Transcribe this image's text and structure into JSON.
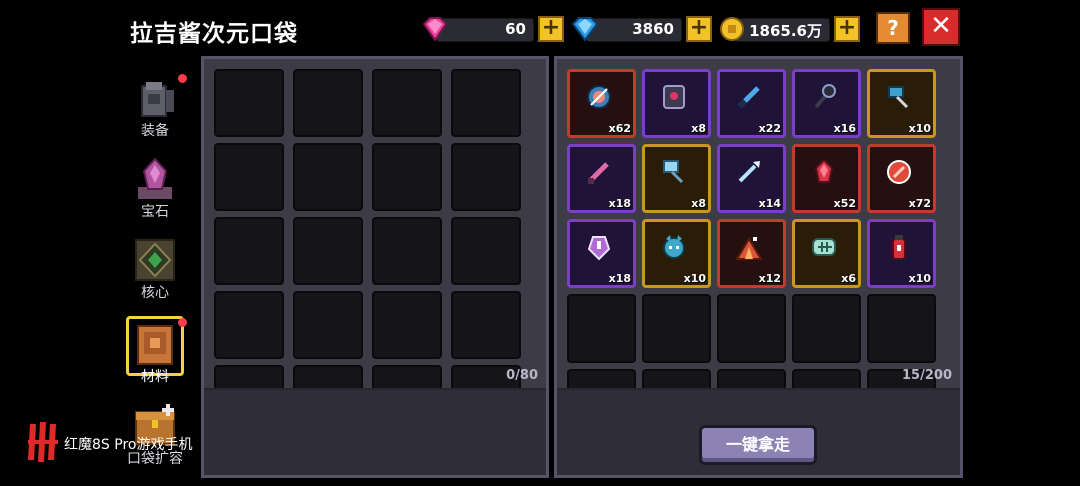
{
  "header": {
    "title": "拉吉酱次元口袋",
    "currencies": [
      {
        "icon": "pink-gem-icon",
        "value": "60"
      },
      {
        "icon": "blue-diamond-icon",
        "value": "3860"
      },
      {
        "icon": "gold-coin-icon",
        "value": "1865.6万"
      }
    ],
    "help_label": "?",
    "close_label": "✕"
  },
  "sidebar": {
    "tabs": [
      {
        "label": "装备",
        "icon": "equipment-icon",
        "badge": true,
        "active": false
      },
      {
        "label": "宝石",
        "icon": "gemstone-icon",
        "badge": false,
        "active": false
      },
      {
        "label": "核心",
        "icon": "core-icon",
        "badge": false,
        "active": false
      },
      {
        "label": "材料",
        "icon": "materials-icon",
        "badge": true,
        "active": true
      },
      {
        "label": "口袋扩容",
        "icon": "pocket-expand-icon",
        "badge": false,
        "active": false
      }
    ]
  },
  "left_panel": {
    "capacity": "0/80"
  },
  "right_panel": {
    "capacity": "15/200",
    "items": [
      {
        "icon": "compass-icon",
        "count": "x62",
        "rarity": "red"
      },
      {
        "icon": "shield-badge-icon",
        "count": "x8",
        "rarity": "purple"
      },
      {
        "icon": "blue-blade-icon",
        "count": "x22",
        "rarity": "purple"
      },
      {
        "icon": "dark-mace-icon",
        "count": "x16",
        "rarity": "purple"
      },
      {
        "icon": "blue-hammer-icon",
        "count": "x10",
        "rarity": "gold"
      },
      {
        "icon": "pink-sword-icon",
        "count": "x18",
        "rarity": "purple"
      },
      {
        "icon": "ice-hammer-icon",
        "count": "x8",
        "rarity": "gold"
      },
      {
        "icon": "ice-spear-icon",
        "count": "x14",
        "rarity": "purple"
      },
      {
        "icon": "red-crystal-icon",
        "count": "x52",
        "rarity": "red"
      },
      {
        "icon": "red-orb-icon",
        "count": "x72",
        "rarity": "red"
      },
      {
        "icon": "purple-potion-icon",
        "count": "x18",
        "rarity": "purple"
      },
      {
        "icon": "blue-creature-icon",
        "count": "x10",
        "rarity": "gold"
      },
      {
        "icon": "fire-pile-icon",
        "count": "x12",
        "rarity": "red"
      },
      {
        "icon": "fish-skeleton-icon",
        "count": "x6",
        "rarity": "gold"
      },
      {
        "icon": "red-extinguisher-icon",
        "count": "x10",
        "rarity": "purple"
      }
    ],
    "take_all_label": "一键拿走"
  },
  "watermark": {
    "text": "红魔8S Pro游戏手机"
  },
  "colors": {
    "red": "#c03d2e",
    "purple": "#7a3fc3",
    "gold": "#c99622",
    "button": "#8c83b4",
    "badge": "#ff3b4e"
  }
}
